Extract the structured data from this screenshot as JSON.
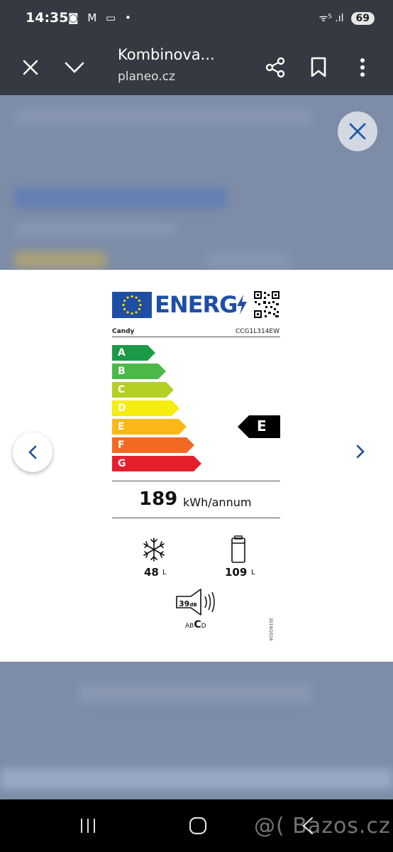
{
  "status": {
    "time": "14:35",
    "icons_left": "◙ M ▭ •",
    "signal": "ᯤ⁵ .ıl",
    "battery": "69"
  },
  "toolbar": {
    "title": "Kombinova...",
    "domain": "planeo.cz"
  },
  "label": {
    "energy_word": "ENERG",
    "brand": "Candy",
    "model": "CCG1L314EW",
    "classes": [
      {
        "letter": "A",
        "color": "#1a9a46"
      },
      {
        "letter": "B",
        "color": "#4cb847"
      },
      {
        "letter": "C",
        "color": "#b5cf25"
      },
      {
        "letter": "D",
        "color": "#f7ec0f"
      },
      {
        "letter": "E",
        "color": "#fbb715"
      },
      {
        "letter": "F",
        "color": "#f26a21"
      },
      {
        "letter": "G",
        "color": "#e5202c"
      }
    ],
    "rating": "E",
    "kwh": "189",
    "kwh_unit": "kWh/annum",
    "freezer_volume": "48",
    "freezer_unit": "L",
    "fridge_volume": "109",
    "fridge_unit": "L",
    "noise_value": "39",
    "noise_unit": "dB",
    "noise_classes_prefix": "AB",
    "noise_class_current": "C",
    "noise_classes_suffix": "D",
    "regulation": "2019/2016"
  },
  "watermark": "@( Bazos.cz"
}
